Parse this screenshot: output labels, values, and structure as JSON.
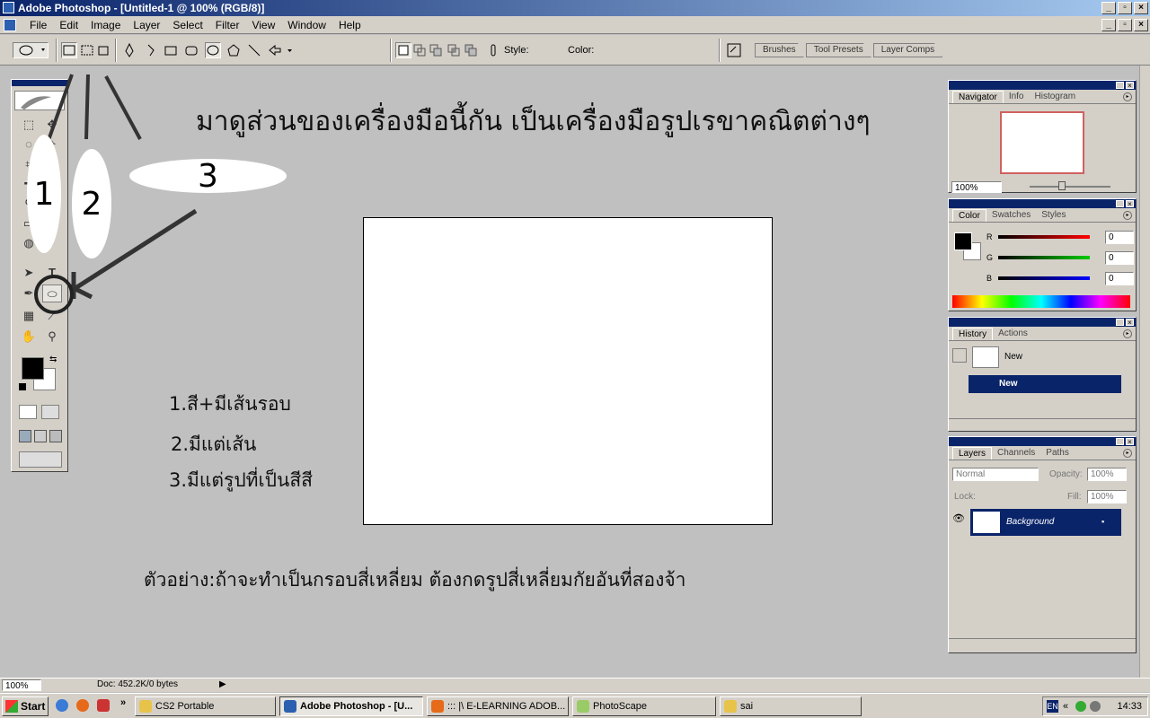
{
  "window": {
    "title": "Adobe Photoshop - [Untitled-1 @ 100% (RGB/8)]"
  },
  "menu": [
    "File",
    "Edit",
    "Image",
    "Layer",
    "Select",
    "Filter",
    "View",
    "Window",
    "Help"
  ],
  "options": {
    "style_label": "Style:",
    "color_label": "Color:",
    "color_value": "#000000"
  },
  "palette_well": [
    "Brushes",
    "Tool Presets",
    "Layer Comps"
  ],
  "annotations": {
    "heading": "มาดูส่วนของเครื่องมือนี้กัน เป็นเครื่องมือรูปเรขาคณิตต่างๆ",
    "num1": "1",
    "num2": "2",
    "num3": "3",
    "list1": "1.สี+มีเส้นรอบ",
    "list2": "2.มีแต่เส้น",
    "list3": "3.มีแต่รูปที่เป็นสีสี",
    "example": "ตัวอย่าง:ถ้าจะทำเป็นกรอบสี่เหลี่ยม ต้องกดรูปสี่เหลี่ยมกัยอันที่สองจ้า"
  },
  "navigator": {
    "tabs": [
      "Navigator",
      "Info",
      "Histogram"
    ],
    "zoom": "100%"
  },
  "color_panel": {
    "tabs": [
      "Color",
      "Swatches",
      "Styles"
    ],
    "r_label": "R",
    "g_label": "G",
    "b_label": "B",
    "r": "0",
    "g": "0",
    "b": "0"
  },
  "history": {
    "tabs": [
      "History",
      "Actions"
    ],
    "snapshot": "New",
    "state": "New"
  },
  "layers": {
    "tabs": [
      "Layers",
      "Channels",
      "Paths"
    ],
    "blend": "Normal",
    "opacity_label": "Opacity:",
    "opacity": "100%",
    "lock_label": "Lock:",
    "fill_label": "Fill:",
    "fill": "100%",
    "layer_name": "Background"
  },
  "status": {
    "zoom": "100%",
    "doc": "Doc: 452.2K/0 bytes"
  },
  "taskbar": {
    "start": "Start",
    "tasks": [
      "CS2 Portable",
      "Adobe Photoshop - [U...",
      "::: |\\ E-LEARNING ADOB...",
      "PhotoScape",
      "sai"
    ],
    "lang": "EN",
    "clock": "14:33"
  }
}
